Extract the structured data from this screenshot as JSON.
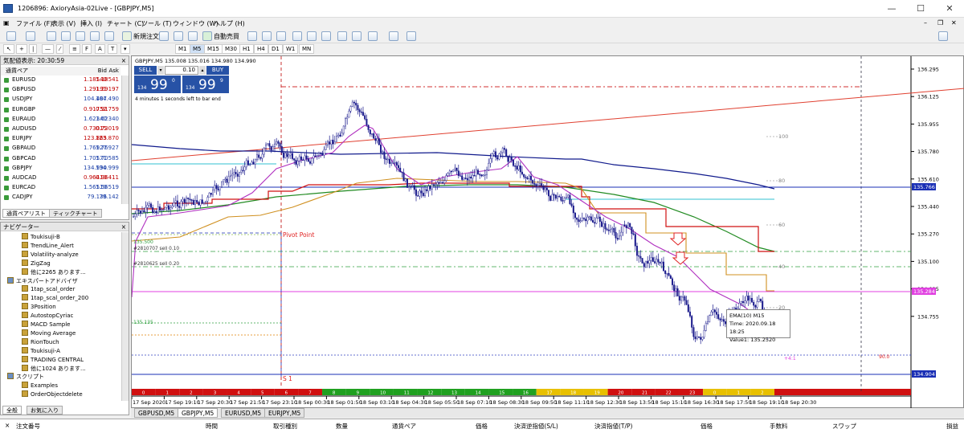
{
  "window": {
    "title": "1206896: AxioryAsia-02Live - [GBPJPY,M5]"
  },
  "menu": [
    "ファイル (F)",
    "表示 (V)",
    "挿入 (I)",
    "チャート (C)",
    "ツール (T)",
    "ウィンドウ (W)",
    "ヘルプ (H)"
  ],
  "toolbar": {
    "new_order": "新規注文",
    "auto_trade": "自動売買"
  },
  "timeframes": [
    "M1",
    "M5",
    "M15",
    "M30",
    "H1",
    "H4",
    "D1",
    "W1",
    "MN"
  ],
  "market_watch": {
    "title": "気配値表示: 20:30:59",
    "headers": {
      "symbol": "通貨ペア",
      "bid": "Bid",
      "ask": "Ask"
    },
    "rows": [
      {
        "symbol": "EURUSD",
        "bid": "1.18540",
        "ask": "1.18541",
        "color": "#c00000"
      },
      {
        "symbol": "GBPUSD",
        "bid": "1.29191",
        "ask": "1.29197",
        "color": "#c00000"
      },
      {
        "symbol": "USDJPY",
        "bid": "104.487",
        "ask": "104.490",
        "color": "#1a3fa8"
      },
      {
        "symbol": "EURGBP",
        "bid": "0.91752",
        "ask": "0.91759",
        "color": "#c00000"
      },
      {
        "symbol": "EURAUD",
        "bid": "1.62340",
        "ask": "1.62340",
        "color": "#1a3fa8"
      },
      {
        "symbol": "AUDUSD",
        "bid": "0.73015",
        "ask": "0.73019",
        "color": "#c00000"
      },
      {
        "symbol": "EURJPY",
        "bid": "123.865",
        "ask": "123.870",
        "color": "#c00000"
      },
      {
        "symbol": "GBPAUD",
        "bid": "1.76927",
        "ask": "1.76927",
        "color": "#1a3fa8"
      },
      {
        "symbol": "GBPCAD",
        "bid": "1.70571",
        "ask": "1.70585",
        "color": "#1a3fa8"
      },
      {
        "symbol": "GBPJPY",
        "bid": "134.990",
        "ask": "134.999",
        "color": "#1a3fa8"
      },
      {
        "symbol": "AUDCAD",
        "bid": "0.96410",
        "ask": "0.96411",
        "color": "#c00000"
      },
      {
        "symbol": "EURCAD",
        "bid": "1.56510",
        "ask": "1.56519",
        "color": "#1a3fa8"
      },
      {
        "symbol": "CADJPY",
        "bid": "79.136",
        "ask": "79.142",
        "color": "#1a3fa8"
      }
    ],
    "tabs": [
      "通貨ペアリスト",
      "ティックチャート"
    ]
  },
  "navigator": {
    "title": "ナビゲーター",
    "items": [
      {
        "label": "Toukisuji-B",
        "indent": 2
      },
      {
        "label": "TrendLine_Alert",
        "indent": 2
      },
      {
        "label": "Volatility-analyze",
        "indent": 2
      },
      {
        "label": "ZigZag",
        "indent": 2
      },
      {
        "label": "他に2265 あります...",
        "indent": 2
      },
      {
        "label": "エキスパートアドバイザ",
        "indent": 1
      },
      {
        "label": "1tap_scal_order",
        "indent": 2
      },
      {
        "label": "1tap_scal_order_200",
        "indent": 2
      },
      {
        "label": "3Position",
        "indent": 2
      },
      {
        "label": "AutostopCyriac",
        "indent": 2
      },
      {
        "label": "MACD Sample",
        "indent": 2
      },
      {
        "label": "Moving Average",
        "indent": 2
      },
      {
        "label": "RionTouch",
        "indent": 2
      },
      {
        "label": "Toukisuji-A",
        "indent": 2
      },
      {
        "label": "TRADING CENTRAL",
        "indent": 2
      },
      {
        "label": "他に1024 あります...",
        "indent": 2
      },
      {
        "label": "スクリプト",
        "indent": 1
      },
      {
        "label": "Examples",
        "indent": 2
      },
      {
        "label": "OrderObjectdelete",
        "indent": 2
      }
    ],
    "tabs": [
      "全般",
      "お気に入り"
    ]
  },
  "chart": {
    "header": "GBPJPY,M5  135.008 135.016 134.980 134.990",
    "sell_label": "SELL",
    "buy_label": "BUY",
    "lot": "0.10",
    "sell_big": "99",
    "sell_small": "134",
    "sell_sup": "0",
    "buy_big": "99",
    "buy_small": "134",
    "buy_sup": "9",
    "countdown": "4 minutes 1 seconds left to bar end",
    "pivot_label": "Pivot Point",
    "s1_label": "S 1",
    "order1": "#2810707 sell 0.10",
    "order2": "#2810625 sell 0.20",
    "level_left_1": "135.500",
    "level_left_2": "135.135",
    "fib": [
      "100",
      "80",
      "60",
      "40",
      "20"
    ],
    "tooltip": {
      "line1": "EMA(10) M15",
      "line2": "Time: 2020.09.18 18:25",
      "line3": "Value1: 135.2520"
    },
    "right_note": "+4:1",
    "red_note": "90.0",
    "price_axis": [
      "136.295",
      "136.125",
      "135.955",
      "135.780",
      "135.610",
      "135.440",
      "135.270",
      "135.100",
      "134.925",
      "134.755"
    ],
    "price_tags": [
      {
        "text": "135.766",
        "color": "#1a2fb5"
      },
      {
        "text": "135.284",
        "color": "#e040e0"
      },
      {
        "text": "134.904",
        "color": "#1a2fb5"
      }
    ],
    "time_axis": [
      "17 Sep 2020",
      "17 Sep 19:10",
      "17 Sep 20:30",
      "17 Sep 21:50",
      "17 Sep 23:10",
      "18 Sep 00:30",
      "18 Sep 01:50",
      "18 Sep 03:10",
      "18 Sep 04:30",
      "18 Sep 05:50",
      "18 Sep 07:10",
      "18 Sep 08:30",
      "18 Sep 09:50",
      "18 Sep 11:10",
      "18 Sep 12:30",
      "18 Sep 13:50",
      "18 Sep 15:10",
      "18 Sep 16:30",
      "18 Sep 17:50",
      "18 Sep 19:10",
      "18 Sep 20:30"
    ],
    "hour_strip": [
      "0",
      "1",
      "2",
      "3",
      "4",
      "5",
      "6",
      "7",
      "8",
      "9",
      "10",
      "11",
      "12",
      "13",
      "14",
      "15",
      "16",
      "17",
      "18",
      "19",
      "20",
      "21",
      "22",
      "23",
      "0",
      "1",
      "2"
    ]
  },
  "chart_tabs": [
    "GBPUSD,M5",
    "GBPJPY,M5",
    "EURUSD,M5",
    "EURJPY,M5"
  ],
  "terminal_headers": [
    "注文番号",
    "時間",
    "取引種別",
    "数量",
    "通貨ペア",
    "価格",
    "決済逆指値(S/L)",
    "決済指値(T/P)",
    "価格",
    "手数料",
    "スワップ",
    "損益"
  ]
}
